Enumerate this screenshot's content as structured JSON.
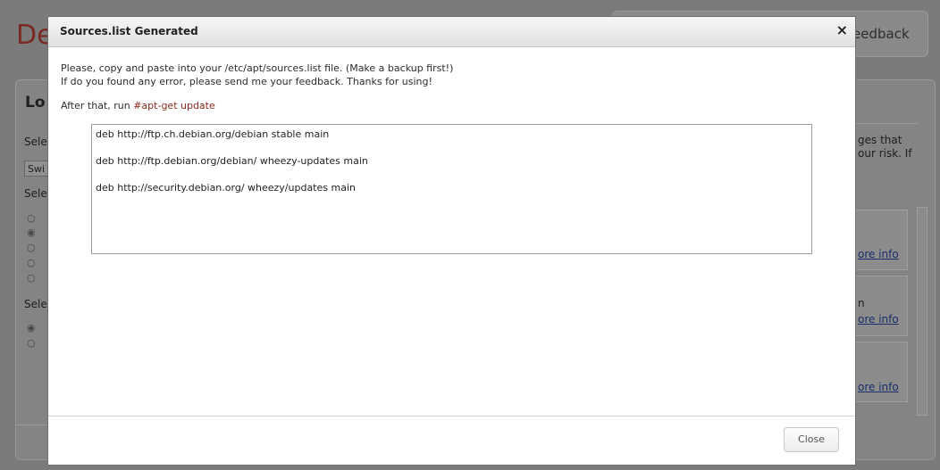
{
  "background": {
    "title_fragment": "De",
    "feedback_fragment": "eedback",
    "panel_title_fragment": "Lo",
    "left_labels": [
      "Sele",
      "Sele",
      "Sele"
    ],
    "select_fragment": "Swi",
    "right_text_1": "ges that",
    "right_text_2": "our risk. If",
    "right_text_3": "n",
    "more_info_links": [
      "ore info",
      "ore info",
      "ore info"
    ]
  },
  "modal": {
    "title": "Sources.list Generated",
    "close_icon": "×",
    "instruction_line_1": "Please, copy and paste into your /etc/apt/sources.list file. (Make a backup first!)",
    "instruction_line_2": "If do you found any error, please send me your feedback. Thanks for using!",
    "after_text": "After that, run ",
    "after_command": "#apt-get update",
    "sources": [
      "deb http://ftp.ch.debian.org/debian stable main",
      "deb http://ftp.debian.org/debian/ wheezy-updates main",
      "deb http://security.debian.org/ wheezy/updates main"
    ],
    "close_button": "Close"
  }
}
